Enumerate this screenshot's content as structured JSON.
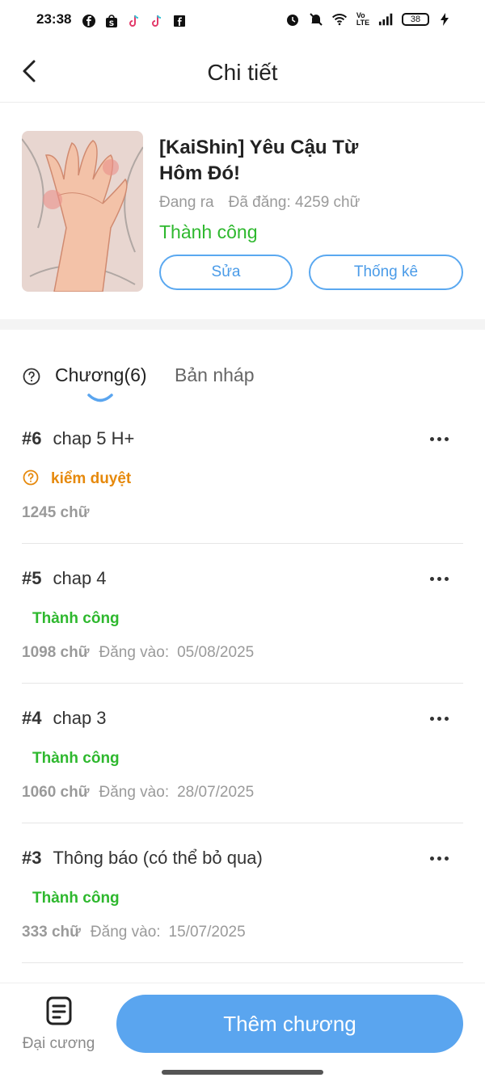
{
  "status_bar": {
    "time": "23:38",
    "battery": "38",
    "left_icons": [
      "facebook-icon",
      "shopee-icon",
      "tiktok-icon",
      "tiktok-icon",
      "facebook-page-icon"
    ],
    "right_icons": [
      "alarm-icon",
      "mute-icon",
      "wifi-icon",
      "volte-icon",
      "signal-icon"
    ]
  },
  "header": {
    "title": "Chi tiết"
  },
  "book": {
    "title": "[KaiShin] Yêu Cậu Từ Hôm Đó!",
    "status_label": "Đang ra",
    "word_count": "Đã đăng: 4259 chữ",
    "publish_status": "Thành công",
    "edit_label": "Sửa",
    "stats_label": "Thống kê"
  },
  "tabs": {
    "chapters": "Chương(6)",
    "drafts": "Bản nháp"
  },
  "chapters": [
    {
      "num": "#6",
      "title": "chap 5 H+",
      "status": "kiểm duyệt",
      "words": "1245 chữ",
      "posted_label": "",
      "date": ""
    },
    {
      "num": "#5",
      "title": "chap 4",
      "status": "Thành công",
      "words": "1098 chữ",
      "posted_label": "Đăng vào:",
      "date": "05/08/2025"
    },
    {
      "num": "#4",
      "title": "chap 3",
      "status": "Thành công",
      "words": "1060 chữ",
      "posted_label": "Đăng vào:",
      "date": "28/07/2025"
    },
    {
      "num": "#3",
      "title": "Thông báo (có thể bỏ qua)",
      "status": "Thành công",
      "words": "333 chữ",
      "posted_label": "Đăng vào:",
      "date": "15/07/2025"
    }
  ],
  "bottom": {
    "outline_label": "Đại cương",
    "add_chapter_label": "Thêm chương"
  },
  "colors": {
    "accent": "#5aa5ef",
    "success": "#2eb82e",
    "review": "#e6890c"
  }
}
